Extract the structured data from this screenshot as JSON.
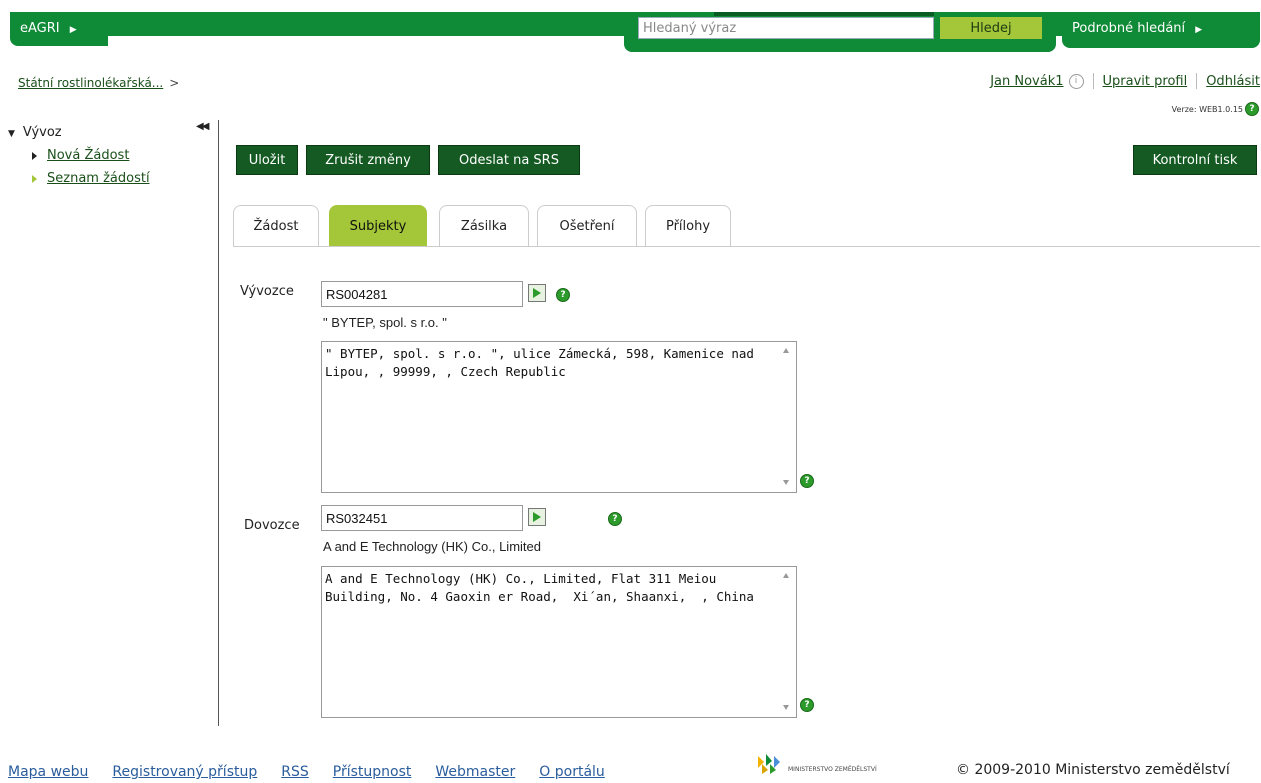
{
  "topbar": {
    "brand": "eAGRI",
    "search_placeholder": "Hledaný výraz",
    "search_button": "Hledej",
    "advanced_search": "Podrobné hledání"
  },
  "breadcrumb": {
    "root": "Státní rostlinolékařská...",
    "separator": ">"
  },
  "user": {
    "name": "Jan Novák1",
    "edit_profile": "Upravit profil",
    "logout": "Odhlásit"
  },
  "version": "Verze: WEB1.0.15",
  "sidebar": {
    "group": "Vývoz",
    "items": [
      {
        "label": "Nová Žádost"
      },
      {
        "label": "Seznam žádostí"
      }
    ]
  },
  "toolbar": {
    "save": "Uložit",
    "cancel": "Zrušit změny",
    "send": "Odeslat na SRS",
    "print": "Kontrolní tisk"
  },
  "tabs": [
    {
      "label": "Žádost"
    },
    {
      "label": "Subjekty",
      "active": true
    },
    {
      "label": "Zásilka"
    },
    {
      "label": "Ošetření"
    },
    {
      "label": "Přílohy"
    }
  ],
  "exporter": {
    "label": "Vývozce",
    "code": "RS004281",
    "name": "\" BYTEP, spol. s r.o. \"",
    "address": "\" BYTEP, spol. s r.o. \", ulice Zámecká, 598, Kamenice nad Lipou, , 99999, , Czech Republic"
  },
  "importer": {
    "label": "Dovozce",
    "code": "RS032451",
    "name": "A and E Technology (HK) Co., Limited",
    "address": "A and E Technology (HK) Co., Limited, Flat 311 Meiou Building, No. 4 Gaoxin er Road,  Xi´an, Shaanxi,  , China"
  },
  "footer": {
    "links": [
      "Mapa webu",
      "Registrovaný přístup",
      "RSS",
      "Přístupnost",
      "Webmaster",
      "O portálu"
    ],
    "logo_text": "MINISTERSTVO ZEMĚDĚLSTVÍ",
    "copyright": "© 2009-2010 Ministerstvo zemědělství"
  },
  "colors": {
    "brand_green": "#0f8a36",
    "accent_lime": "#a4c639",
    "button_dark": "#145a22"
  }
}
